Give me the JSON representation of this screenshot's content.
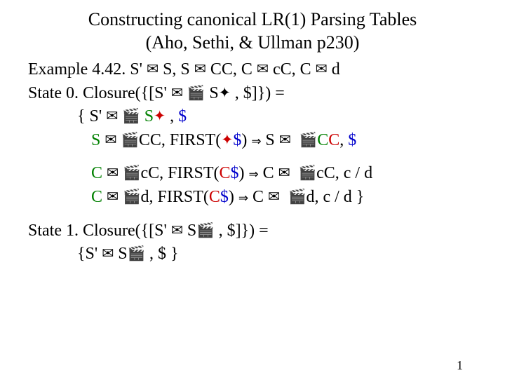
{
  "title1": "Constructing canonical LR(1) Parsing Tables",
  "title2": "(Aho, Sethi, & Ullman p230)",
  "sym": {
    "msg": "✉",
    "clap": "🎬",
    "star": "✦",
    "arrow2": "⇒"
  },
  "ex": {
    "lead": "Example 4.42. S' ",
    "p1": "S, S ",
    "p2": " CC, C ",
    "p3": " cC, C ",
    "p4": " d"
  },
  "s0": {
    "head": "State 0. Closure({[S' ",
    "mid1": "S",
    "mid2": " , $]}) =",
    "l1a": "{ S' ",
    "l1b": "S",
    "l1c": " , ",
    "l1dollar": "$",
    "l2a": "S",
    "l2b": "CC, FIRST(",
    "l2c": "$",
    "l2d": ") ",
    "l2e": " S ",
    "l2f": "C",
    "l2g": "C",
    "l2h": ", ",
    "l2i": "$",
    "l3a": "C",
    "l3b": "cC, FIRST(",
    "l3c": "C",
    "l3d": "$",
    "l3e": ") ",
    "l3f": " C ",
    "l3g": "cC, c / d",
    "l4a": "C",
    "l4b": "d, FIRST(",
    "l4c": "C",
    "l4d": "$",
    "l4e": ") ",
    "l4f": " C ",
    "l4g": "d, c / d }"
  },
  "s1": {
    "head": "State 1. Closure({[S' ",
    "mid1": "S",
    "mid2": " , $]}) =",
    "body1": "{S' ",
    "body2": " S",
    "body3": ", $ }"
  },
  "page": "1"
}
